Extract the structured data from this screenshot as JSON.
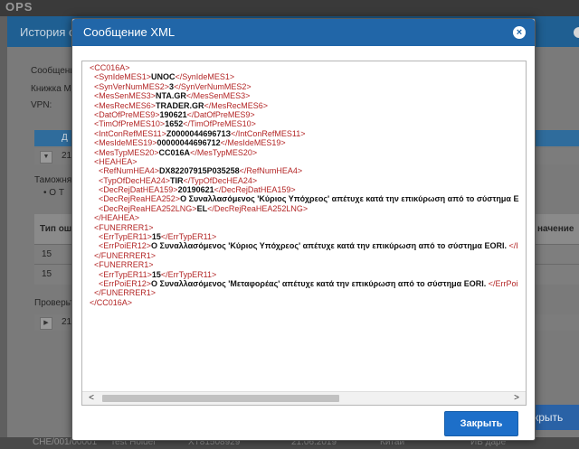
{
  "background": {
    "brand": "OPS",
    "window_title": "История с",
    "labels": [
      "Сообщени",
      "Книжка МД",
      "VPN:"
    ],
    "bar_text": "Д",
    "row1_text": "21",
    "customs_label": "Таможня",
    "bullet_text": "• О Т",
    "table_header_left": "Тип ош",
    "table_header_right": "начение",
    "table_rows": [
      "15",
      "15"
    ],
    "check_label": "Проверьт",
    "row2_text": "21",
    "right_close_button": "крыть",
    "bottom_items": [
      "CHE/001/00001",
      "Test Holder",
      "XT81508929",
      "21.06.2019",
      "Китай",
      "ИВ даре"
    ]
  },
  "dialog": {
    "title": "Сообщение XML",
    "close_button": "Закрыть",
    "xml_lines": [
      {
        "pre": "<CC016A>",
        "val": "",
        "post": ""
      },
      {
        "pre": "  <SynIdeMES1>",
        "val": "UNOC",
        "post": "</SynIdeMES1>"
      },
      {
        "pre": "  <SynVerNumMES2>",
        "val": "3",
        "post": "</SynVerNumMES2>"
      },
      {
        "pre": "  <MesSenMES3>",
        "val": "NTA.GR",
        "post": "</MesSenMES3>"
      },
      {
        "pre": "  <MesRecMES6>",
        "val": "TRADER.GR",
        "post": "</MesRecMES6>"
      },
      {
        "pre": "  <DatOfPreMES9>",
        "val": "190621",
        "post": "</DatOfPreMES9>"
      },
      {
        "pre": "  <TimOfPreMES10>",
        "val": "1652",
        "post": "</TimOfPreMES10>"
      },
      {
        "pre": "  <IntConRefMES11>",
        "val": "Z000004469671З",
        "post": "</IntConRefMES11>"
      },
      {
        "pre": "  <MesIdeMES19>",
        "val": "00000044696712",
        "post": "</MesIdeMES19>"
      },
      {
        "pre": "  <MesTypMES20>",
        "val": "CC016A",
        "post": "</MesTypMES20>"
      },
      {
        "pre": "  <HEAHEA>",
        "val": "",
        "post": ""
      },
      {
        "pre": "    <RefNumHEA4>",
        "val": "DX82207915P035258",
        "post": "</RefNumHEA4>"
      },
      {
        "pre": "    <TypOfDecHEA24>",
        "val": "TIR",
        "post": "</TypOfDecHEA24>"
      },
      {
        "pre": "    <DecRejDatHEA159>",
        "val": "20190621",
        "post": "</DecRejDatHEA159>"
      },
      {
        "pre": "    <DecRejReaHEA252>",
        "val": "Ο Συναλλασόμενος 'Κύριος Υπόχρεος' απέτυχε κατά την επικύρωση από το σύστημα E",
        "post": ""
      },
      {
        "pre": "    <DecRejReaHEA252LNG>",
        "val": "EL",
        "post": "</DecRejReaHEA252LNG>"
      },
      {
        "pre": "  </HEAHEA>",
        "val": "",
        "post": ""
      },
      {
        "pre": "  <FUNERRER1>",
        "val": "",
        "post": ""
      },
      {
        "pre": "    <ErrTypER11>",
        "val": "15",
        "post": "</ErrTypER11>"
      },
      {
        "pre": "    <ErrPoiER12>",
        "val": "Ο Συναλλασόμενος 'Κύριος Υπόχρεος' απέτυχε κατά την επικύρωση από το σύστημα EORI. ",
        "post": "</I"
      },
      {
        "pre": "  </FUNERRER1>",
        "val": "",
        "post": ""
      },
      {
        "pre": "  <FUNERRER1>",
        "val": "",
        "post": ""
      },
      {
        "pre": "    <ErrTypER11>",
        "val": "15",
        "post": "</ErrTypER11>"
      },
      {
        "pre": "    <ErrPoiER12>",
        "val": "Ο Συναλλασόμενος 'Μεταφορέας' απέτυχε κατά την επικύρωση από το σύστημα EORI. ",
        "post": "</ErrPoi"
      },
      {
        "pre": "  </FUNERRER1>",
        "val": "",
        "post": ""
      },
      {
        "pre": "</CC016A>",
        "val": "",
        "post": ""
      }
    ],
    "scroll_left_glyph": "<",
    "scroll_right_glyph": ">",
    "close_icon_glyph": "×"
  },
  "colors": {
    "accent": "#2166a8",
    "button": "#1d6fc9",
    "xml_tag": "#b32626"
  }
}
